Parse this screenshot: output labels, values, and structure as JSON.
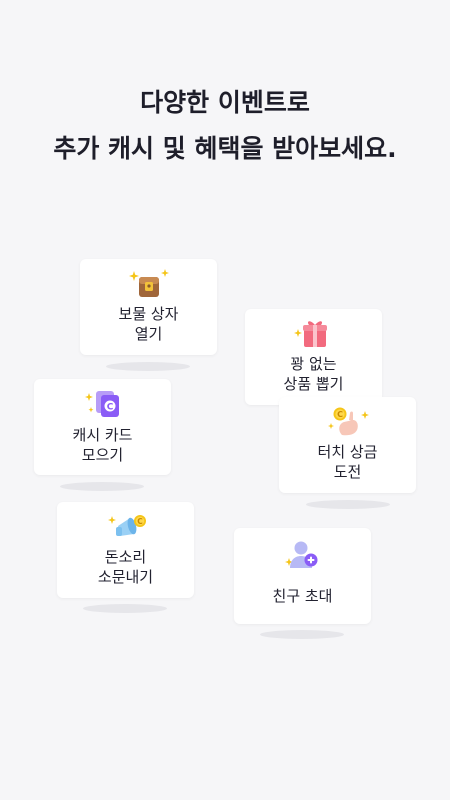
{
  "headline": {
    "line1": "다양한 이벤트로",
    "line2": "추가 캐시 및 혜택을 받아보세요."
  },
  "events": {
    "treasure": {
      "line1": "보물 상자",
      "line2": "열기",
      "icon": "treasure-chest-icon"
    },
    "gift": {
      "line1": "꽝 없는",
      "line2": "상품 뽑기",
      "icon": "gift-box-icon"
    },
    "cards": {
      "line1": "캐시 카드",
      "line2": "모으기",
      "icon": "cash-card-icon",
      "badge": "C"
    },
    "touch": {
      "line1": "터치 상금",
      "line2": "도전",
      "icon": "touch-coin-icon",
      "badge": "C"
    },
    "sound": {
      "line1": "돈소리",
      "line2": "소문내기",
      "icon": "megaphone-coin-icon",
      "badge": "C"
    },
    "friend": {
      "label": "친구 초대",
      "icon": "invite-friend-icon"
    }
  },
  "colors": {
    "background": "#f6f6f8",
    "accent_purple": "#8a5cf6",
    "sparkle_gold": "#f5c518",
    "gift_pink": "#f26a7e"
  }
}
